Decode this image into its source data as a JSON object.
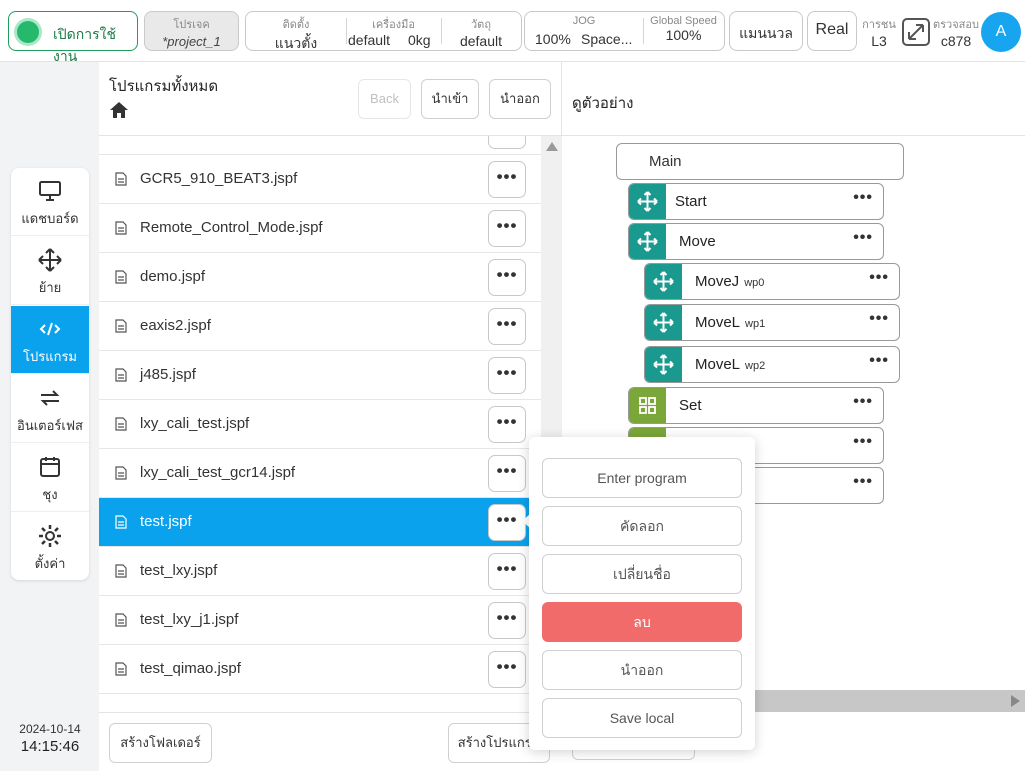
{
  "topbar": {
    "power_label": "เปิดการใช้งาน",
    "project_label": "โปรเจค",
    "project_value": "*project_1",
    "install_label": "ติดตั้ง",
    "install_value": "แนวตั้ง",
    "tool_label": "เครื่องมือ",
    "tool_value": "default",
    "tool_weight": "0kg",
    "object_label": "วัตถุ",
    "object_value": "default",
    "jog_label": "JOG",
    "jog_value": "100%",
    "jog_space": "Space...",
    "speed_label": "Global Speed",
    "speed_value": "100%",
    "manual_label": "แมนนวล",
    "real_label": "Real",
    "collision_label": "การชน",
    "collision_value": "L3",
    "check_label": "ตรวจสอบ",
    "check_value": "c878",
    "avatar": "A"
  },
  "nav": {
    "items": [
      {
        "label": "แดชบอร์ด",
        "icon": "monitor-icon"
      },
      {
        "label": "ย้าย",
        "icon": "move-icon"
      },
      {
        "label": "โปรแกรม",
        "icon": "code-icon"
      },
      {
        "label": "อินเตอร์เฟส",
        "icon": "interface-icon"
      },
      {
        "label": "ชุง",
        "icon": "calendar-icon"
      },
      {
        "label": "ตั้งค่า",
        "icon": "gear-icon"
      }
    ],
    "active": "โปรแกรม"
  },
  "clock": {
    "date": "2024-10-14",
    "time": "14:15:46"
  },
  "files": {
    "title": "โปรแกรมทั้งหมด",
    "back_label": "Back",
    "import_label": "นำเข้า",
    "export_label": "นำออก",
    "items": [
      "GCR5_910_BEAT3.jspf",
      "Remote_Control_Mode.jspf",
      "demo.jspf",
      "eaxis2.jspf",
      "j485.jspf",
      "lxy_cali_test.jspf",
      "lxy_cali_test_gcr14.jspf",
      "test.jspf",
      "test_lxy.jspf",
      "test_lxy_j1.jspf",
      "test_qimao.jspf"
    ],
    "selected": "test.jspf",
    "more_label": "•••",
    "new_folder_label": "สร้างโฟลเดอร์",
    "new_program_label": "สร้างโปรแกรม"
  },
  "preview": {
    "title": "ดูตัวอย่าง",
    "root": "Main",
    "nodes": [
      {
        "name": "Start",
        "wp": ""
      },
      {
        "name": "Move",
        "wp": ""
      },
      {
        "name": "MoveJ",
        "wp": "wp0"
      },
      {
        "name": "MoveL",
        "wp": "wp1"
      },
      {
        "name": "MoveL",
        "wp": "wp2"
      },
      {
        "name": "Set",
        "wp": ""
      }
    ],
    "dots": "•••"
  },
  "context_menu": {
    "items": [
      "Enter program",
      "คัดลอก",
      "เปลี่ยนชื่อ",
      "ลบ",
      "นำออก",
      "Save local"
    ]
  }
}
